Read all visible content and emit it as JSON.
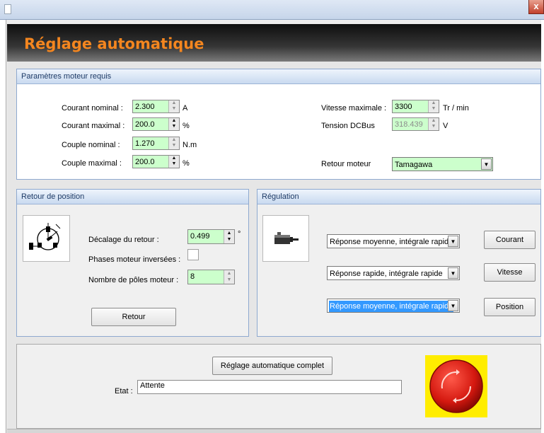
{
  "window": {
    "close_glyph": "x"
  },
  "header": {
    "title": "Réglage automatique",
    "title_color": "#f4861f"
  },
  "motor_params": {
    "title": "Paramètres moteur requis",
    "courant_nominal": {
      "label": "Courant nominal :",
      "value": "2.300",
      "unit": "A"
    },
    "courant_maximal": {
      "label": "Courant maximal :",
      "value": "200.0",
      "unit": "%"
    },
    "couple_nominal": {
      "label": "Couple nominal :",
      "value": "1.270",
      "unit": "N.m"
    },
    "couple_maximal": {
      "label": "Couple maximal :",
      "value": "200.0",
      "unit": "%"
    },
    "vitesse_maximale": {
      "label": "Vitesse maximale :",
      "value": "3300",
      "unit": "Tr / min"
    },
    "tension_dcbus": {
      "label": "Tension DCBus",
      "value": "318.439",
      "unit": "V"
    },
    "retour_moteur": {
      "label": "Retour moteur",
      "value": "Tamagawa"
    }
  },
  "position_feedback": {
    "title": "Retour de position",
    "decalage": {
      "label": "Décalage du retour :",
      "value": "0.499",
      "unit": "°"
    },
    "phases_inversees": {
      "label": "Phases moteur inversées :",
      "checked": false
    },
    "nb_poles": {
      "label": "Nombre de  pôles moteur :",
      "value": "8"
    },
    "retour_button": "Retour",
    "icon": "encoder-icon"
  },
  "regulation": {
    "title": "Régulation",
    "icon": "motor-icon",
    "rows": [
      {
        "option": "Réponse moyenne, intégrale rapide",
        "button": "Courant"
      },
      {
        "option": "Réponse rapide, intégrale rapide",
        "button": "Vitesse"
      },
      {
        "option": "Réponse moyenne, intégrale rapide",
        "button": "Position"
      }
    ]
  },
  "footer": {
    "full_button": "Réglage automatique complet",
    "etat_label": "Etat :",
    "etat_value": "Attente",
    "stop_icon": "emergency-stop-icon",
    "stop_color": "#e11b1b",
    "stop_bg": "#ffed00"
  },
  "colors": {
    "field_bg": "#ccffcc",
    "panel_border": "#8ea9cf",
    "selection": "#3399ff"
  }
}
